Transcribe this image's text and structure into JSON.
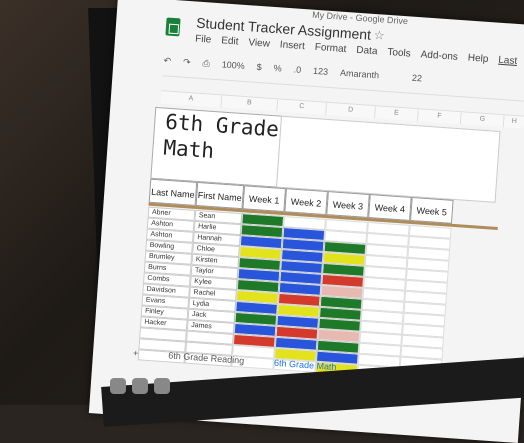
{
  "chrome": {
    "title": "My Drive - Google Drive"
  },
  "doc": {
    "title": "Student Tracker Assignment"
  },
  "menu": [
    "File",
    "Edit",
    "View",
    "Insert",
    "Format",
    "Data",
    "Tools",
    "Add-ons",
    "Help",
    "Last"
  ],
  "toolbar": {
    "zoom": "100%",
    "currency": "$",
    "percent": "%",
    "decimal": ".0",
    "more_formats": "123",
    "font": "Amaranth",
    "font_size": "22"
  },
  "columns": [
    "A",
    "B",
    "C",
    "D",
    "E",
    "F",
    "G",
    "H"
  ],
  "sheet": {
    "title_line1": "6th Grade",
    "title_line2": "Math",
    "headers": [
      "Last Name",
      "First Name",
      "Week 1",
      "Week 2",
      "Week 3",
      "Week 4",
      "Week 5"
    ],
    "rows": [
      {
        "last": "Abner",
        "first": "Sean",
        "weeks": [
          "#1e7a28",
          "",
          "",
          "",
          ""
        ]
      },
      {
        "last": "Ashton",
        "first": "Harlie",
        "weeks": [
          "#1e7a28",
          "#2855d9",
          "",
          "",
          ""
        ]
      },
      {
        "last": "Ashton",
        "first": "Hannah",
        "weeks": [
          "#2855d9",
          "#2855d9",
          "#1e7a28",
          "",
          ""
        ]
      },
      {
        "last": "Bowling",
        "first": "Chloe",
        "weeks": [
          "#e3e31d",
          "#2855d9",
          "#e3e31d",
          "",
          ""
        ]
      },
      {
        "last": "Brumley",
        "first": "Kirsten",
        "weeks": [
          "#1e7a28",
          "#2855d9",
          "#1e7a28",
          "",
          ""
        ]
      },
      {
        "last": "Burns",
        "first": "Taylor",
        "weeks": [
          "#2855d9",
          "#2855d9",
          "#d33a2c",
          "",
          ""
        ]
      },
      {
        "last": "Combs",
        "first": "Kylee",
        "weeks": [
          "#1e7a28",
          "#2855d9",
          "#e8b9b0",
          "",
          ""
        ]
      },
      {
        "last": "Davidson",
        "first": "Rachel",
        "weeks": [
          "#e3e31d",
          "#d33a2c",
          "#1e7a28",
          "",
          ""
        ]
      },
      {
        "last": "Evans",
        "first": "Lydia",
        "weeks": [
          "#2855d9",
          "#e3e31d",
          "#1e7a28",
          "",
          ""
        ]
      },
      {
        "last": "Finley",
        "first": "Jack",
        "weeks": [
          "#1e7a28",
          "#2855d9",
          "#1e7a28",
          "",
          ""
        ]
      },
      {
        "last": "Hacker",
        "first": "James",
        "weeks": [
          "#2855d9",
          "#d33a2c",
          "#e8b9b0",
          "",
          ""
        ]
      },
      {
        "last": "",
        "first": "",
        "weeks": [
          "#d33a2c",
          "#2855d9",
          "#1e7a28",
          "",
          ""
        ]
      },
      {
        "last": "",
        "first": "",
        "weeks": [
          "",
          "#e3e31d",
          "#2855d9",
          "",
          ""
        ]
      },
      {
        "last": "",
        "first": "",
        "weeks": [
          "",
          "",
          "#e3e31d",
          "",
          ""
        ]
      }
    ]
  },
  "tabs": [
    "6th Grade Reading",
    "6th Grade Math"
  ]
}
